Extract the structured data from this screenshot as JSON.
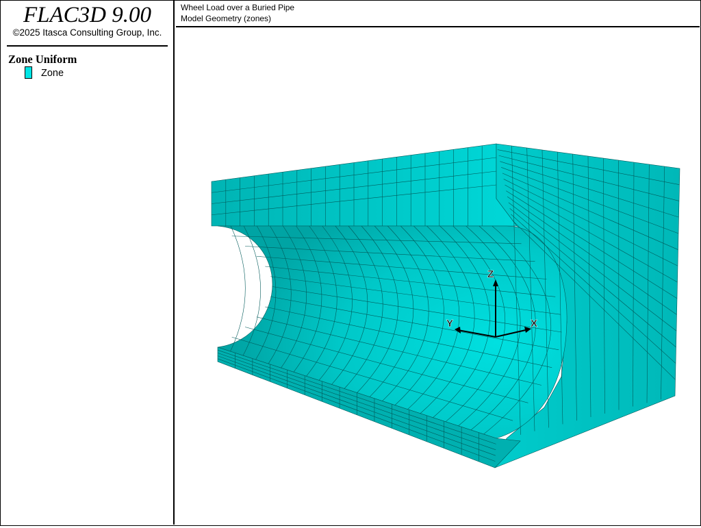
{
  "app": {
    "logo": "FLAC3D 9.00",
    "copyright": "©2025 Itasca Consulting Group, Inc."
  },
  "legend": {
    "title": "Zone Uniform",
    "items": [
      {
        "label": "Zone",
        "color": "#00e5e5"
      }
    ]
  },
  "header": {
    "title": "Wheel Load over a Buried Pipe",
    "subtitle": "Model Geometry (zones)"
  },
  "axes": {
    "x": "X",
    "y": "Y",
    "z": "Z"
  },
  "colors": {
    "zone_light": "#00dada",
    "zone_mid": "#00c2c2",
    "zone_dark": "#00a8a8",
    "mesh_line": "#005a5a"
  }
}
